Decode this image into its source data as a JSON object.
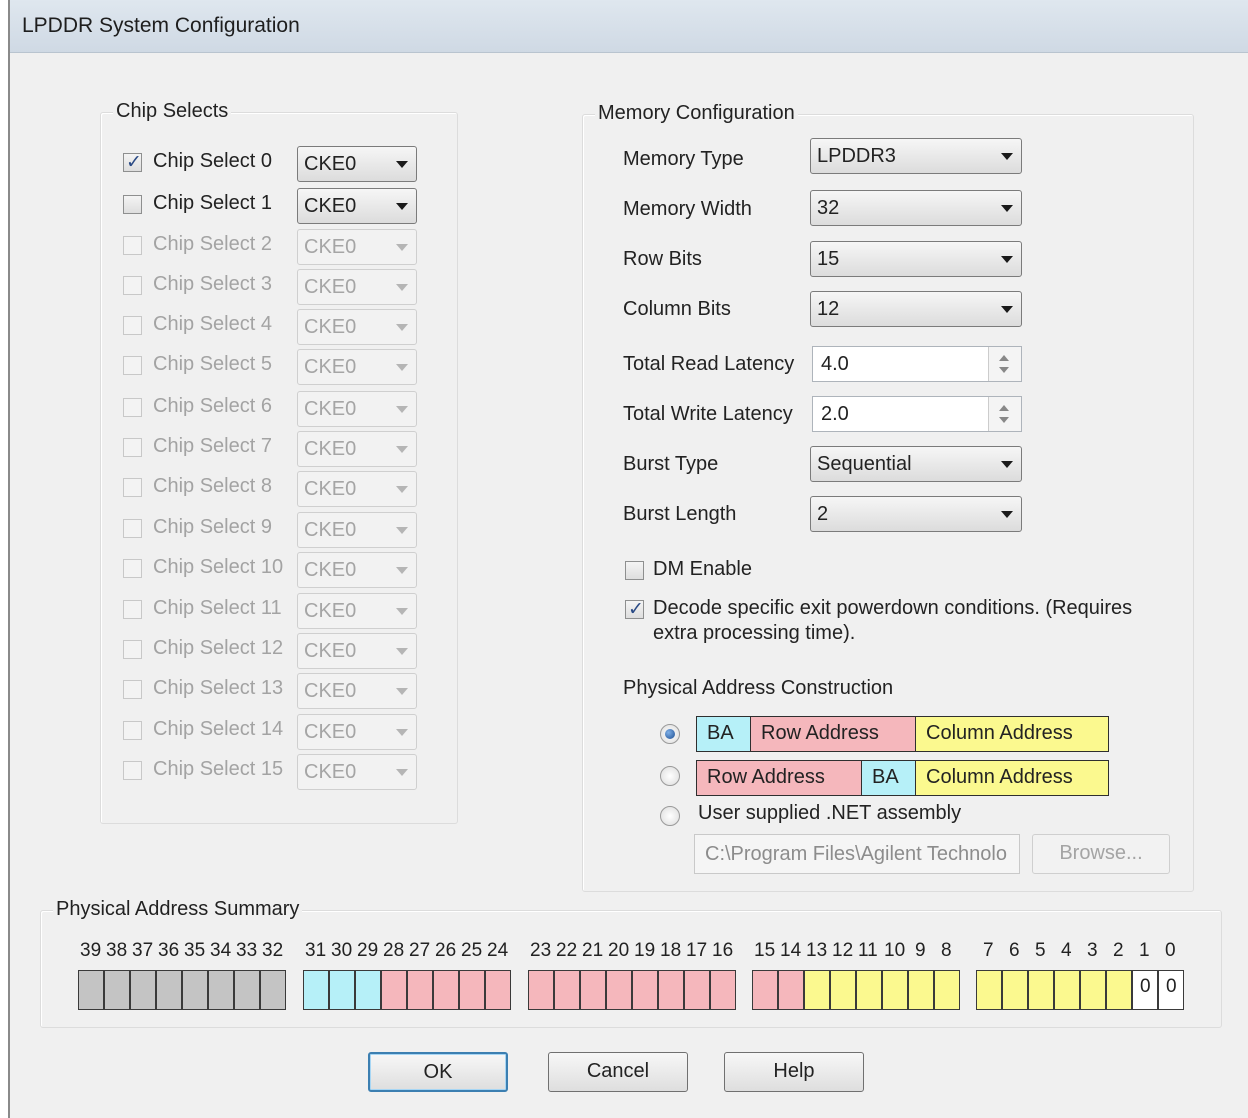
{
  "window": {
    "title": "LPDDR System Configuration"
  },
  "chip_selects": {
    "title": "Chip Selects",
    "items": [
      {
        "label": "Chip Select 0",
        "checked": true,
        "enabled": true,
        "cke": "CKE0"
      },
      {
        "label": "Chip Select 1",
        "checked": false,
        "enabled": true,
        "cke": "CKE0"
      },
      {
        "label": "Chip Select 2",
        "checked": false,
        "enabled": false,
        "cke": "CKE0"
      },
      {
        "label": "Chip Select 3",
        "checked": false,
        "enabled": false,
        "cke": "CKE0"
      },
      {
        "label": "Chip Select 4",
        "checked": false,
        "enabled": false,
        "cke": "CKE0"
      },
      {
        "label": "Chip Select 5",
        "checked": false,
        "enabled": false,
        "cke": "CKE0"
      },
      {
        "label": "Chip Select 6",
        "checked": false,
        "enabled": false,
        "cke": "CKE0"
      },
      {
        "label": "Chip Select 7",
        "checked": false,
        "enabled": false,
        "cke": "CKE0"
      },
      {
        "label": "Chip Select 8",
        "checked": false,
        "enabled": false,
        "cke": "CKE0"
      },
      {
        "label": "Chip Select 9",
        "checked": false,
        "enabled": false,
        "cke": "CKE0"
      },
      {
        "label": "Chip Select 10",
        "checked": false,
        "enabled": false,
        "cke": "CKE0"
      },
      {
        "label": "Chip Select 11",
        "checked": false,
        "enabled": false,
        "cke": "CKE0"
      },
      {
        "label": "Chip Select 12",
        "checked": false,
        "enabled": false,
        "cke": "CKE0"
      },
      {
        "label": "Chip Select 13",
        "checked": false,
        "enabled": false,
        "cke": "CKE0"
      },
      {
        "label": "Chip Select 14",
        "checked": false,
        "enabled": false,
        "cke": "CKE0"
      },
      {
        "label": "Chip Select 15",
        "checked": false,
        "enabled": false,
        "cke": "CKE0"
      }
    ]
  },
  "memory_config": {
    "title": "Memory Configuration",
    "memory_type": {
      "label": "Memory Type",
      "value": "LPDDR3"
    },
    "memory_width": {
      "label": "Memory Width",
      "value": "32"
    },
    "row_bits": {
      "label": "Row Bits",
      "value": "15"
    },
    "column_bits": {
      "label": "Column Bits",
      "value": "12"
    },
    "read_latency": {
      "label": "Total Read Latency",
      "value": "4.0"
    },
    "write_latency": {
      "label": "Total Write Latency",
      "value": "2.0"
    },
    "burst_type": {
      "label": "Burst Type",
      "value": "Sequential"
    },
    "burst_length": {
      "label": "Burst Length",
      "value": "2"
    },
    "dm_enable": {
      "label": "DM Enable",
      "checked": false
    },
    "decode_exit": {
      "line1": "Decode specific exit powerdown conditions. (Requires",
      "line2": "extra processing time).",
      "checked": true
    },
    "pac": {
      "title": "Physical Address Construction",
      "opt1": {
        "ba": "BA",
        "row": "Row Address",
        "col": "Column  Address",
        "selected": true
      },
      "opt2": {
        "row": "Row Address",
        "ba": "BA",
        "col": "Column  Address",
        "selected": false
      },
      "opt3": {
        "label": "User supplied .NET assembly",
        "selected": false
      },
      "path": "C:\\Program Files\\Agilent Technolo",
      "browse": "Browse..."
    }
  },
  "summary": {
    "title": "Physical Address  Summary",
    "groups": [
      {
        "bits": [
          "39",
          "38",
          "37",
          "36",
          "35",
          "34",
          "33",
          "32"
        ],
        "colors": [
          "gray",
          "gray",
          "gray",
          "gray",
          "gray",
          "gray",
          "gray",
          "gray"
        ]
      },
      {
        "bits": [
          "31",
          "30",
          "29",
          "28",
          "27",
          "26",
          "25",
          "24"
        ],
        "colors": [
          "cyan",
          "cyan",
          "cyan",
          "pink",
          "pink",
          "pink",
          "pink",
          "pink"
        ]
      },
      {
        "bits": [
          "23",
          "22",
          "21",
          "20",
          "19",
          "18",
          "17",
          "16"
        ],
        "colors": [
          "pink",
          "pink",
          "pink",
          "pink",
          "pink",
          "pink",
          "pink",
          "pink"
        ]
      },
      {
        "bits": [
          "15",
          "14",
          "13",
          "12",
          "11",
          "10",
          "9",
          "8"
        ],
        "colors": [
          "pink",
          "pink",
          "yellow",
          "yellow",
          "yellow",
          "yellow",
          "yellow",
          "yellow"
        ]
      },
      {
        "bits": [
          "7",
          "6",
          "5",
          "4",
          "3",
          "2",
          "1",
          "0"
        ],
        "colors": [
          "yellow",
          "yellow",
          "yellow",
          "yellow",
          "yellow",
          "yellow",
          "white",
          "white"
        ],
        "values": [
          "",
          "",
          "",
          "",
          "",
          "",
          "0",
          "0"
        ]
      }
    ],
    "color_map": {
      "gray": "#c4c4c4",
      "cyan": "#b6f0f8",
      "pink": "#f5b7bc",
      "yellow": "#fbf98f",
      "white": "#ffffff"
    }
  },
  "buttons": {
    "ok": "OK",
    "cancel": "Cancel",
    "help": "Help"
  }
}
